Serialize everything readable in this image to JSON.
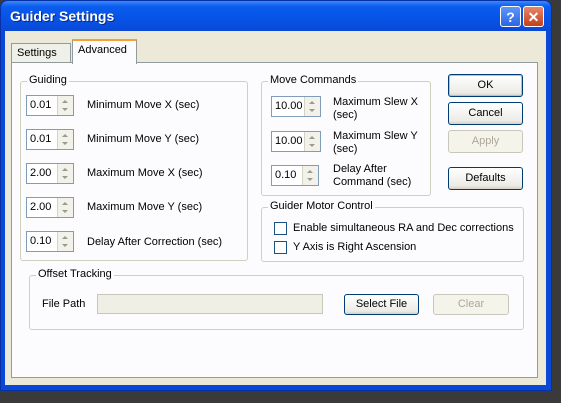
{
  "window": {
    "title": "Guider Settings"
  },
  "titlebar": {
    "help": "?",
    "close": "✕"
  },
  "tabs": [
    {
      "label": "Settings"
    },
    {
      "label": "Advanced"
    }
  ],
  "guiding": {
    "title": "Guiding",
    "rows": [
      {
        "value": "0.01",
        "label": "Minimum Move X (sec)"
      },
      {
        "value": "0.01",
        "label": "Minimum Move Y (sec)"
      },
      {
        "value": "2.00",
        "label": "Maximum Move X (sec)"
      },
      {
        "value": "2.00",
        "label": "Maximum Move Y (sec)"
      },
      {
        "value": "0.10",
        "label": "Delay After Correction (sec)"
      }
    ]
  },
  "move_commands": {
    "title": "Move Commands",
    "rows": [
      {
        "value": "10.00",
        "label1": "Maximum Slew X",
        "label2": "(sec)"
      },
      {
        "value": "10.00",
        "label1": "Maximum Slew Y",
        "label2": "(sec)"
      },
      {
        "value": "0.10",
        "label1": "Delay After",
        "label2": "Command (sec)"
      }
    ]
  },
  "motor_control": {
    "title": "Guider Motor Control",
    "options": [
      {
        "label": "Enable simultaneous RA and Dec corrections",
        "checked": false
      },
      {
        "label": "Y Axis is Right Ascension",
        "checked": false
      }
    ]
  },
  "offset_tracking": {
    "title": "Offset Tracking",
    "file_path_label": "File Path",
    "file_path_value": "",
    "select_file": "Select File",
    "clear": "Clear"
  },
  "buttons": {
    "ok": "OK",
    "cancel": "Cancel",
    "apply": "Apply",
    "defaults": "Defaults"
  }
}
